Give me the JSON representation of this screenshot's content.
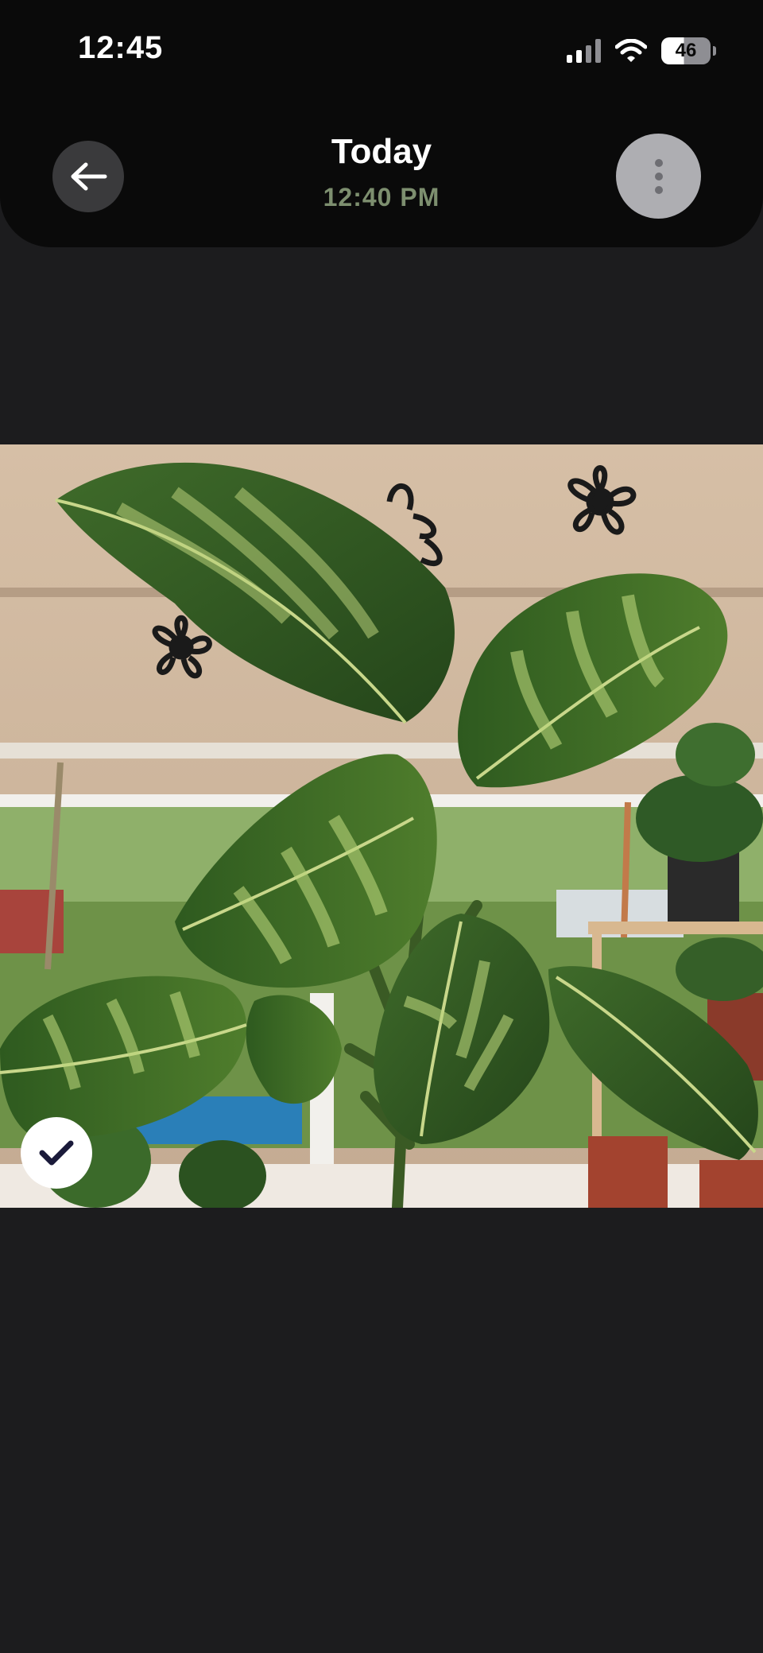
{
  "status_bar": {
    "time": "12:45",
    "battery_level": "46",
    "icons": [
      "cellular-signal-icon",
      "wifi-icon",
      "battery-icon"
    ]
  },
  "header": {
    "title": "Today",
    "timestamp": "12:40 PM",
    "back_icon": "arrow-left-icon",
    "more_icon": "more-vertical-icon"
  },
  "photo": {
    "selected": true,
    "select_icon": "checkmark-icon"
  },
  "colors": {
    "background": "#1c1c1e",
    "topbar": "#0a0a0a",
    "timestamp_accent": "#7d8f6f"
  }
}
